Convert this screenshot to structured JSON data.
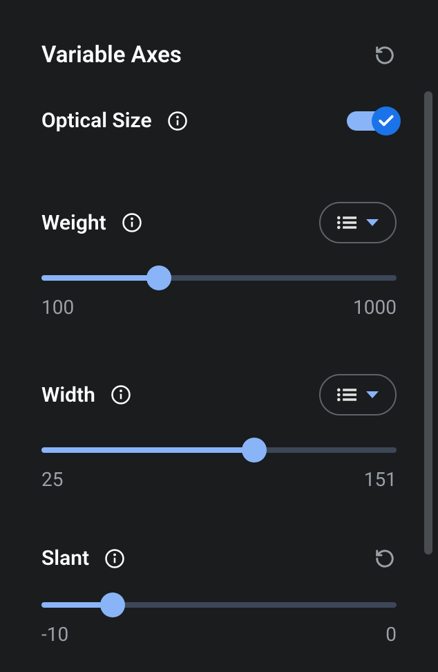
{
  "header": {
    "title": "Variable Axes"
  },
  "axes": {
    "opticalSize": {
      "label": "Optical Size",
      "enabled": true
    },
    "weight": {
      "label": "Weight",
      "min": "100",
      "max": "1000",
      "percent": 33
    },
    "width": {
      "label": "Width",
      "min": "25",
      "max": "151",
      "percent": 60
    },
    "slant": {
      "label": "Slant",
      "min": "-10",
      "max": "0",
      "percent": 20
    }
  }
}
